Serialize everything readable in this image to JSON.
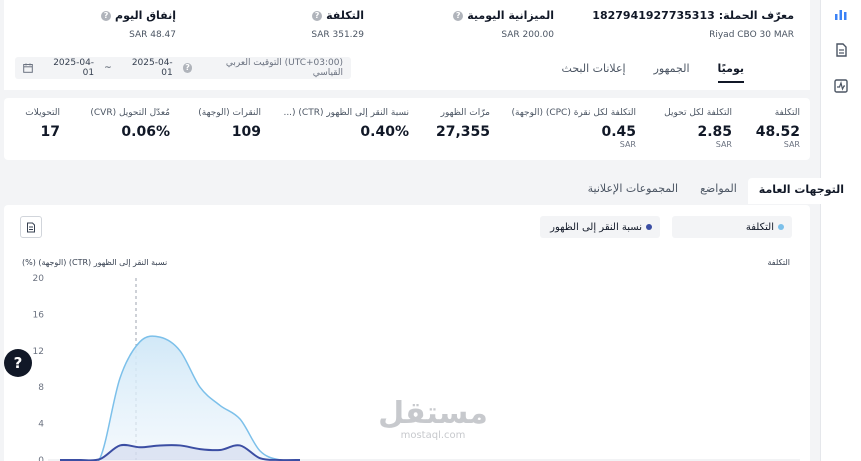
{
  "header": {
    "campaign_id_label": "معرّف الحملة:",
    "campaign_id": "1827941927735313",
    "campaign_name": "Riyad CBO 30 MAR",
    "daily_budget_label": "الميزانية اليومية",
    "daily_budget_value": "SAR 200.00",
    "cost_label": "التكلفة",
    "cost_value": "SAR 351.29",
    "today_spend_label": "إنفاق اليوم",
    "today_spend_value": "SAR 48.47"
  },
  "top_tabs": [
    "يوميًا",
    "الجمهور",
    "إعلانات البحث"
  ],
  "date_range": {
    "timezone": "(UTC+03:00) التوقيت العربي القياسي",
    "start": "2025-04-01",
    "separator": "~",
    "end": "2025-04-01"
  },
  "metrics": [
    {
      "label": "التكلفة",
      "value": "48.52",
      "unit": "SAR"
    },
    {
      "label": "التكلفة لكل تحويل",
      "value": "2.85",
      "unit": "SAR"
    },
    {
      "label": "التكلفة لكل نقرة (CPC) (الوجهة)",
      "value": "0.45",
      "unit": "SAR"
    },
    {
      "label": "مرّات الظهور",
      "value": "27,355",
      "unit": ""
    },
    {
      "label": "نسبة النقر إلى الظهور (CTR) (...",
      "value": "0.40%",
      "unit": ""
    },
    {
      "label": "النقرات (الوجهة)",
      "value": "109",
      "unit": ""
    },
    {
      "label": "مُعدّل التحويل (CVR)",
      "value": "0.06%",
      "unit": ""
    },
    {
      "label": "التحويلات",
      "value": "17",
      "unit": ""
    }
  ],
  "secondary_tabs": [
    "التوجهات العامة",
    "المواضع",
    "المجموعات الإعلانية"
  ],
  "chart_controls": {
    "metric_a": "التكلفة",
    "metric_b": "نسبة النقر إلى الظهور"
  },
  "chart_data": {
    "type": "area",
    "ylabel_left": "نسبة النقر إلى الظهور (CTR) (الوجهة) (%)",
    "ylabel_right": "التكلفة",
    "left_ticks": [
      "20",
      "16",
      "12",
      "8",
      "4",
      "0"
    ],
    "ylim": [
      0,
      20
    ],
    "series": [
      {
        "name": "التكلفة",
        "color": "#7cc0ea",
        "values": [
          0,
          0,
          0.2,
          9,
          13,
          13.5,
          12,
          8,
          6,
          4.5,
          1,
          0,
          0
        ]
      },
      {
        "name": "نسبة النقر إلى الظهور",
        "color": "#3b4ea3",
        "values": [
          0,
          0,
          0.1,
          1.6,
          1.4,
          1.6,
          1.6,
          1.2,
          1.1,
          1.6,
          0.2,
          0,
          0
        ]
      }
    ]
  },
  "watermark": {
    "arabic": "مستقل",
    "latin": "mostaql.com"
  },
  "colors": {
    "accent": "#111827",
    "cost_line": "#7cc0ea",
    "ctr_line": "#3b4ea3"
  }
}
